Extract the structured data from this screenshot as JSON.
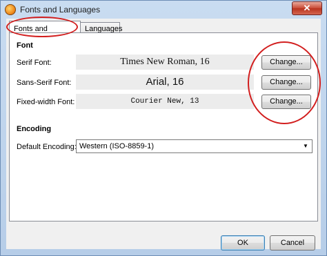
{
  "window": {
    "title": "Fonts and Languages",
    "close_glyph": "✕"
  },
  "tabs": [
    {
      "label": "Fonts and Encoding",
      "active": true
    },
    {
      "label": "Languages",
      "active": false
    }
  ],
  "font_section": {
    "title": "Font",
    "rows": [
      {
        "label": "Serif Font:",
        "value": "Times New Roman, 16",
        "button": "Change..."
      },
      {
        "label": "Sans-Serif Font:",
        "value": "Arial, 16",
        "button": "Change..."
      },
      {
        "label": "Fixed-width Font:",
        "value": "Courier New, 13",
        "button": "Change..."
      }
    ]
  },
  "encoding_section": {
    "title": "Encoding",
    "default_label": "Default Encoding:",
    "selected": "Western (ISO-8859-1)"
  },
  "footer": {
    "ok_label": "OK",
    "cancel_label": "Cancel"
  },
  "colors": {
    "annotation": "#d21e1e",
    "title_bar": "#c9dcf1"
  }
}
